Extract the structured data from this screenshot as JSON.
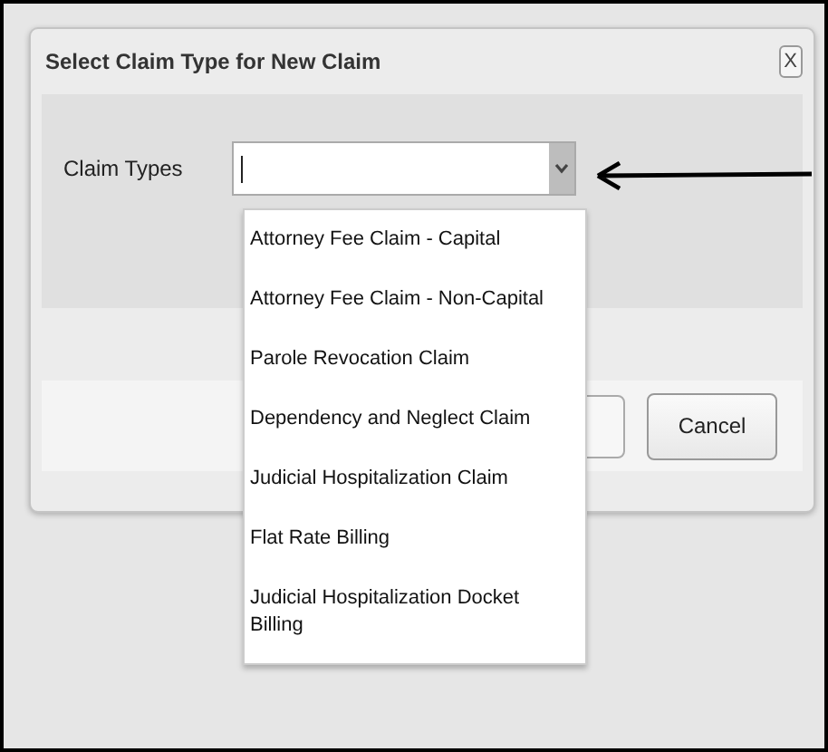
{
  "dialog": {
    "title": "Select Claim Type for New Claim",
    "close_label": "X"
  },
  "field": {
    "label": "Claim Types",
    "expanded": true
  },
  "options": [
    {
      "label": "Attorney Fee Claim - Capital"
    },
    {
      "label": "Attorney Fee Claim - Non-Capital"
    },
    {
      "label": "Parole Revocation Claim"
    },
    {
      "label": "Dependency and Neglect Claim"
    },
    {
      "label": "Judicial Hospitalization Claim"
    },
    {
      "label": "Flat Rate Billing"
    },
    {
      "label": "Judicial Hospitalization Docket Billing"
    }
  ],
  "buttons": [
    {
      "label": "Cancel"
    }
  ]
}
